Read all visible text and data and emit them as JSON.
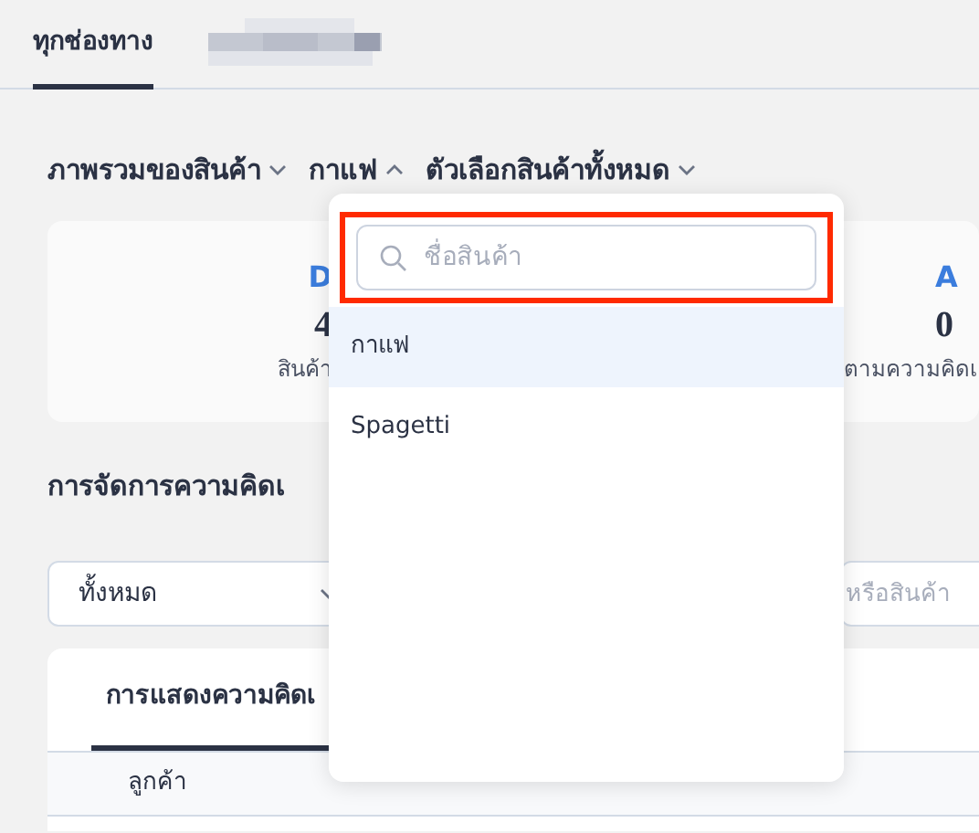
{
  "tabs": [
    {
      "label": "ทุกช่องทาง",
      "selected": true
    }
  ],
  "breadcrumb": [
    {
      "label": "ภาพรวมของสินค้า",
      "expanded": false
    },
    {
      "label": "กาแฟ",
      "expanded": true
    },
    {
      "label": "ตัวเลือกสินค้าทั้งหมด",
      "expanded": false
    }
  ],
  "summary": {
    "left": {
      "letter": "D",
      "value": "4",
      "label": "สินค้า"
    },
    "right": {
      "letter": "A",
      "value": "0",
      "label": "ตามความคิดเ"
    }
  },
  "section_title": "การจัดการความคิดเ",
  "filter": {
    "value": "ทั้งหมด",
    "search_placeholder": "หรือสินค้า"
  },
  "table": {
    "tab": "การแสดงความคิดเ",
    "columns": [
      "ลูกค้า"
    ]
  },
  "dropdown": {
    "search_placeholder": "ชื่อสินค้า",
    "highlighted": true,
    "options": [
      {
        "label": "กาแฟ",
        "selected": true
      },
      {
        "label": "Spagetti",
        "selected": false
      }
    ]
  }
}
